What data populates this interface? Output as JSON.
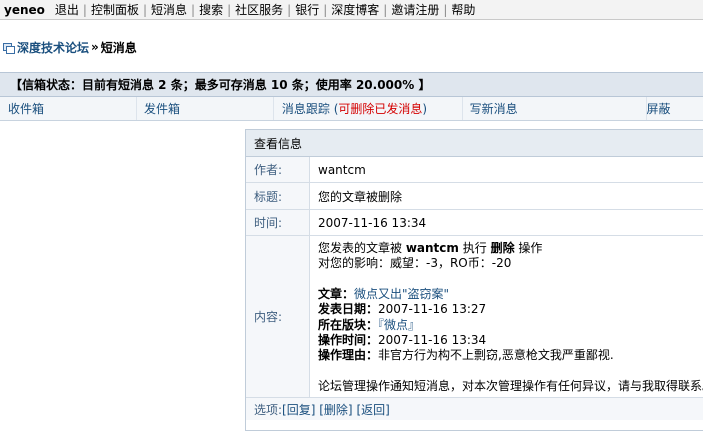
{
  "topnav": {
    "user": "yeneo",
    "items": [
      "退出",
      "控制面板",
      "短消息",
      "搜索",
      "社区服务",
      "银行",
      "深度博客",
      "邀请注册",
      "帮助"
    ]
  },
  "breadcrumb": {
    "forum": "深度技术论坛",
    "arrow": "»",
    "current": "短消息"
  },
  "status": {
    "text": "【信箱状态：目前有短消息 2 条；最多可存消息 10 条；使用率 20.000% 】"
  },
  "tabs": {
    "inbox": "收件箱",
    "outbox": "发件箱",
    "track_prefix": "消息跟踪 (",
    "track_red": "可删除已发消息",
    "track_suffix": ")",
    "compose": "写新消息",
    "block": "屏蔽"
  },
  "message": {
    "header": "查看信息",
    "author_label": "作者:",
    "author": "wantcm",
    "title_label": "标题:",
    "title": "您的文章被删除",
    "time_label": "时间:",
    "time": "2007-11-16 13:34",
    "content_label": "内容:",
    "content": {
      "line1_prefix": "您发表的文章被 ",
      "line1_user": "wantcm",
      "line1_mid": " 执行 ",
      "line1_action": "删除",
      "line1_suffix": " 操作",
      "line2": "对您的影响：威望：-3，RO币：-20",
      "article_label": "文章：",
      "article": "微点又出\"盗窃案\"",
      "post_date_label": "发表日期：",
      "post_date": "2007-11-16 13:27",
      "board_label": "所在版块：",
      "board": "『微点』",
      "op_time_label": "操作时间：",
      "op_time": "2007-11-16 13:34",
      "reason_label": "操作理由：",
      "reason": "非官方行为构不上剽窃,恶意枪文我严重鄙视.",
      "notice": "论坛管理操作通知短消息，对本次管理操作有任何异议，请与我取得联系。"
    },
    "options": {
      "label": "选项: ",
      "reply": "[回复]",
      "delete": "[删除]",
      "back": "[返回]"
    }
  }
}
